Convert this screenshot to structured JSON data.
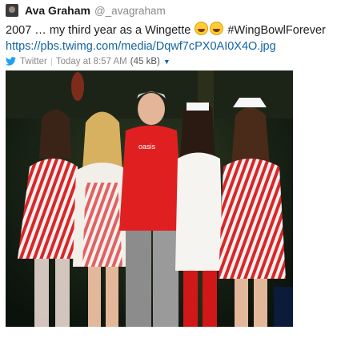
{
  "message": {
    "author_name": "Ava Graham",
    "author_handle": "@_avagraham",
    "text_before_emoji": "2007 … my third year as a Wingette",
    "text_after_emoji": "#WingBowlForever",
    "emoji_icons": [
      "laughing-emoji-icon",
      "laughing-emoji-icon"
    ],
    "link": "https://pbs.twimg.com/media/Dqwf7cPX0AI0X4O.jpg",
    "source": "Twitter",
    "timestamp": "Today at 8:57 AM",
    "file_size": "(45 kB)",
    "caret_icon": "caret-down-icon",
    "bird_icon": "twitter-bird-icon",
    "photo_logo_text": "oasis",
    "colors": {
      "link": "#1264a3",
      "twitter_blue": "#1da1f2",
      "nurse_stripe_red": "#d8262b",
      "shirt_red": "#e02020"
    }
  }
}
